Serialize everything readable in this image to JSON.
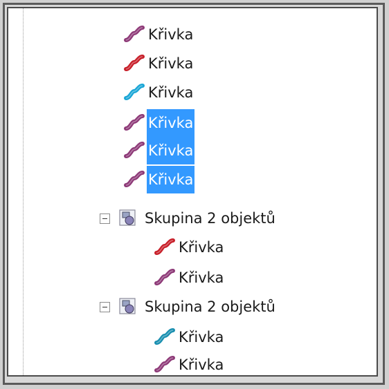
{
  "tree": {
    "items": [
      {
        "label": "Křivka",
        "color": "#8e3a78",
        "selected": false,
        "level": 0
      },
      {
        "label": "Křivka",
        "color": "#c8202a",
        "selected": false,
        "level": 0
      },
      {
        "label": "Křivka",
        "color": "#1aa6d6",
        "selected": false,
        "level": 0
      },
      {
        "label": "Křivka",
        "color": "#8e3a78",
        "selected": true,
        "level": 0
      },
      {
        "label": "Křivka",
        "color": "#8e3a78",
        "selected": true,
        "level": 0
      },
      {
        "label": "Křivka",
        "color": "#8e3a78",
        "selected": true,
        "level": 0
      }
    ],
    "groups": [
      {
        "label": "Skupina 2 objektů",
        "expander": "collapse",
        "children": [
          {
            "label": "Křivka",
            "color": "#c8202a"
          },
          {
            "label": "Křivka",
            "color": "#8e3a78"
          }
        ]
      },
      {
        "label": "Skupina 2 objektů",
        "expander": "collapse",
        "children": [
          {
            "label": "Křivka",
            "color": "#1a8fb0"
          },
          {
            "label": "Křivka",
            "color": "#8e3a78"
          }
        ]
      }
    ]
  }
}
